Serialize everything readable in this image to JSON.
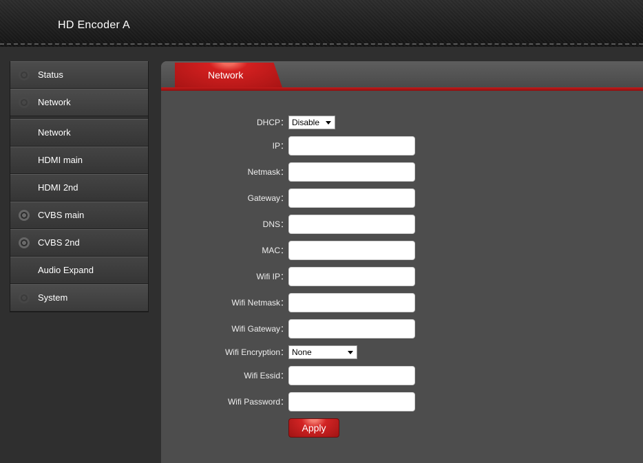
{
  "header": {
    "title": "HD Encoder  A"
  },
  "sidebar": {
    "items": [
      {
        "label": "Status",
        "icon": "status-icon"
      },
      {
        "label": "Network",
        "icon": "network-icon"
      },
      {
        "label": "Network"
      },
      {
        "label": "HDMI main"
      },
      {
        "label": "HDMI 2nd"
      },
      {
        "label": "CVBS main",
        "icon": "cvbs-icon"
      },
      {
        "label": "CVBS 2nd",
        "icon": "cvbs-icon"
      },
      {
        "label": "Audio Expand"
      },
      {
        "label": "System",
        "icon": "system-icon"
      }
    ]
  },
  "tab": {
    "label": "Network"
  },
  "form": {
    "dhcp": {
      "label": "DHCP：",
      "value": "Disable"
    },
    "ip": {
      "label": "IP：",
      "value": ""
    },
    "netmask": {
      "label": "Netmask：",
      "value": ""
    },
    "gateway": {
      "label": "Gateway：",
      "value": ""
    },
    "dns": {
      "label": "DNS：",
      "value": ""
    },
    "mac": {
      "label": "MAC：",
      "value": ""
    },
    "wifi_ip": {
      "label": "Wifi IP：",
      "value": ""
    },
    "wifi_netmask": {
      "label": "Wifi Netmask：",
      "value": ""
    },
    "wifi_gateway": {
      "label": "Wifi Gateway：",
      "value": ""
    },
    "wifi_encryption": {
      "label": "Wifi Encryption：",
      "value": "None"
    },
    "wifi_essid": {
      "label": "Wifi Essid：",
      "value": ""
    },
    "wifi_password": {
      "label": "Wifi Password：",
      "value": ""
    },
    "apply_label": "Apply"
  },
  "colors": {
    "accent": "#c41a1a",
    "panel": "#4d4d4d",
    "background": "#2f2f2f"
  }
}
